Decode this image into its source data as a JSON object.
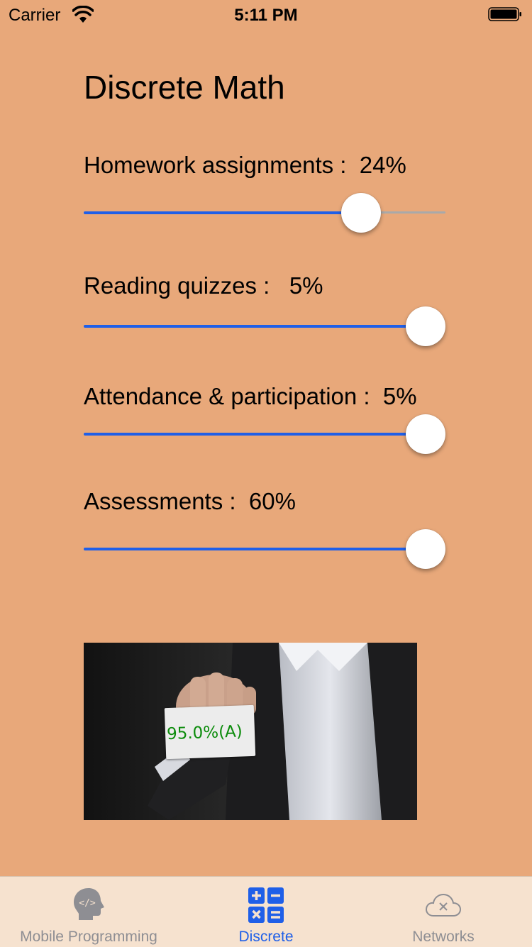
{
  "status_bar": {
    "carrier": "Carrier",
    "time": "5:11 PM"
  },
  "page": {
    "title": "Discrete Math"
  },
  "sliders": [
    {
      "label": "Homework assignments :  24%",
      "value": 0.8
    },
    {
      "label": "Reading quizzes :   5%",
      "value": 1.0
    },
    {
      "label": "Attendance & participation :  5%",
      "value": 1.0
    },
    {
      "label": "Assessments :  60%",
      "value": 1.0
    }
  ],
  "result": {
    "grade_text": "95.0%(A)"
  },
  "tab_bar": {
    "tabs": [
      {
        "label": "Mobile Programming",
        "icon": "head-code-icon",
        "selected": false
      },
      {
        "label": "Discrete",
        "icon": "calculator-icon",
        "selected": true
      },
      {
        "label": "Networks",
        "icon": "cloud-error-icon",
        "selected": false
      }
    ]
  },
  "colors": {
    "background": "#E8A87A",
    "slider_tint": "#1F5FE8",
    "tab_selected": "#1F5FE8",
    "tab_unselected": "#8E8E93",
    "grade_text": "#0C8C0C"
  }
}
